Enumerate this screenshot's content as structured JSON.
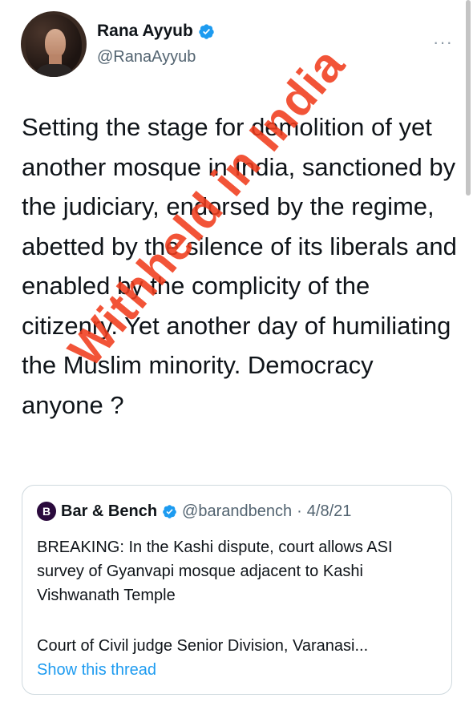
{
  "author": {
    "name": "Rana Ayyub",
    "handle": "@RanaAyyub"
  },
  "tweet": {
    "text": "Setting the stage for demolition of yet another mosque in India, sanctioned by the judiciary, endorsed by the regime, abetted by the silence of its liberals and enabled by the complicity of the citizenry. Yet another day of humiliating the Muslim minority. Democracy anyone ?"
  },
  "quote": {
    "logo": "B",
    "name": "Bar & Bench",
    "handle": "@barandbench",
    "separator": "·",
    "date": "4/8/21",
    "text": "BREAKING: In the Kashi dispute, court allows ASI survey of Gyanvapi mosque adjacent to Kashi Vishwanath Temple",
    "text2": "Court of Civil judge Senior Division, Varanasi...",
    "show_thread": "Show this thread"
  },
  "watermark": "Withheld in India",
  "more_label": "···",
  "icons": {
    "verified": "verified-badge-icon",
    "more": "more-options-icon"
  },
  "colors": {
    "verified": "#1d9bf0",
    "link": "#1d9bf0",
    "watermark": "#f03c1c",
    "secondary_text": "#536471"
  }
}
